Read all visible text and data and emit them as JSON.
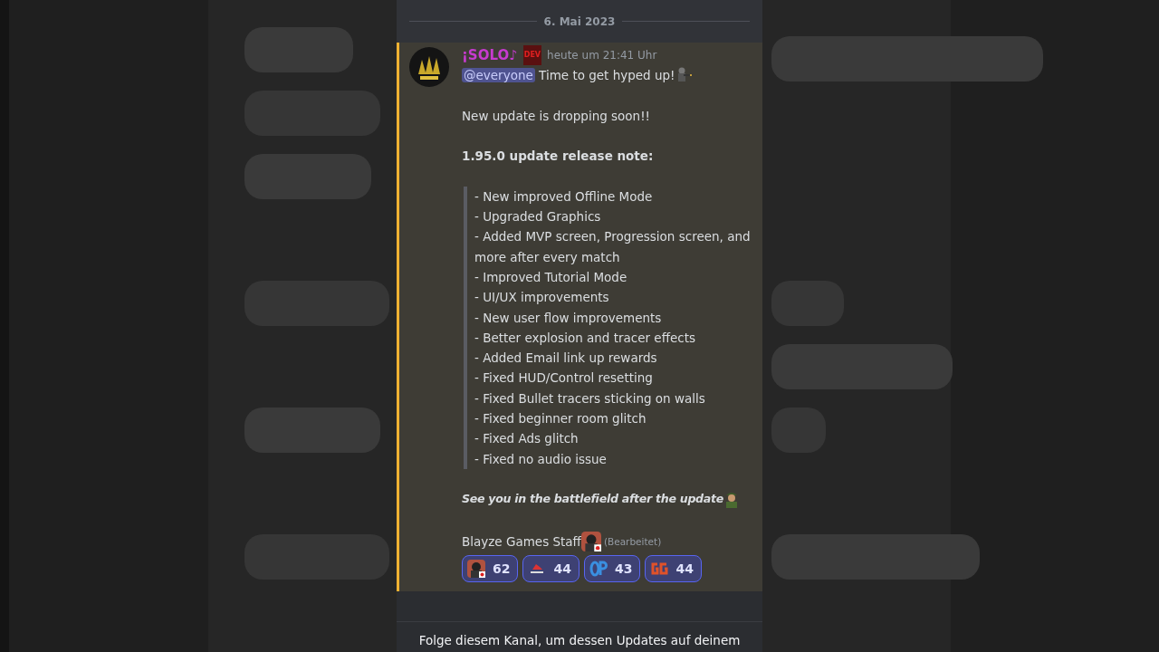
{
  "date_divider": "6. Mai 2023",
  "message": {
    "highlighted": true,
    "author": "¡SOLO♪",
    "badge": "DEV",
    "timestamp": "heute um 21:41 Uhr",
    "mention": "@everyone",
    "first_line": "Time to get hyped up!",
    "announcement": "New update is dropping soon!!",
    "heading": "1.95.0 update release note:",
    "quote_lines": [
      "- New improved Offline Mode",
      "- Upgraded Graphics",
      "- Added MVP screen, Progression screen, and more after every match",
      "- Improved Tutorial Mode",
      "- UI/UX improvements",
      "- New user flow improvements",
      "- Better explosion and tracer effects",
      "- Added Email link up rewards",
      "- Fixed HUD/Control resetting",
      "- Fixed Bullet tracers sticking on walls",
      "- Fixed beginner room glitch",
      "- Fixed Ads glitch",
      "- Fixed no audio issue"
    ],
    "closing": "See you in the battlefield after the update",
    "signature": "Blayze Games Staff",
    "edited": "(Bearbeitet)"
  },
  "reactions": [
    {
      "count": "62"
    },
    {
      "count": "44"
    },
    {
      "count": "43"
    },
    {
      "count": "44"
    }
  ],
  "footer": "Folge diesem Kanal, um dessen Updates auf deinem"
}
